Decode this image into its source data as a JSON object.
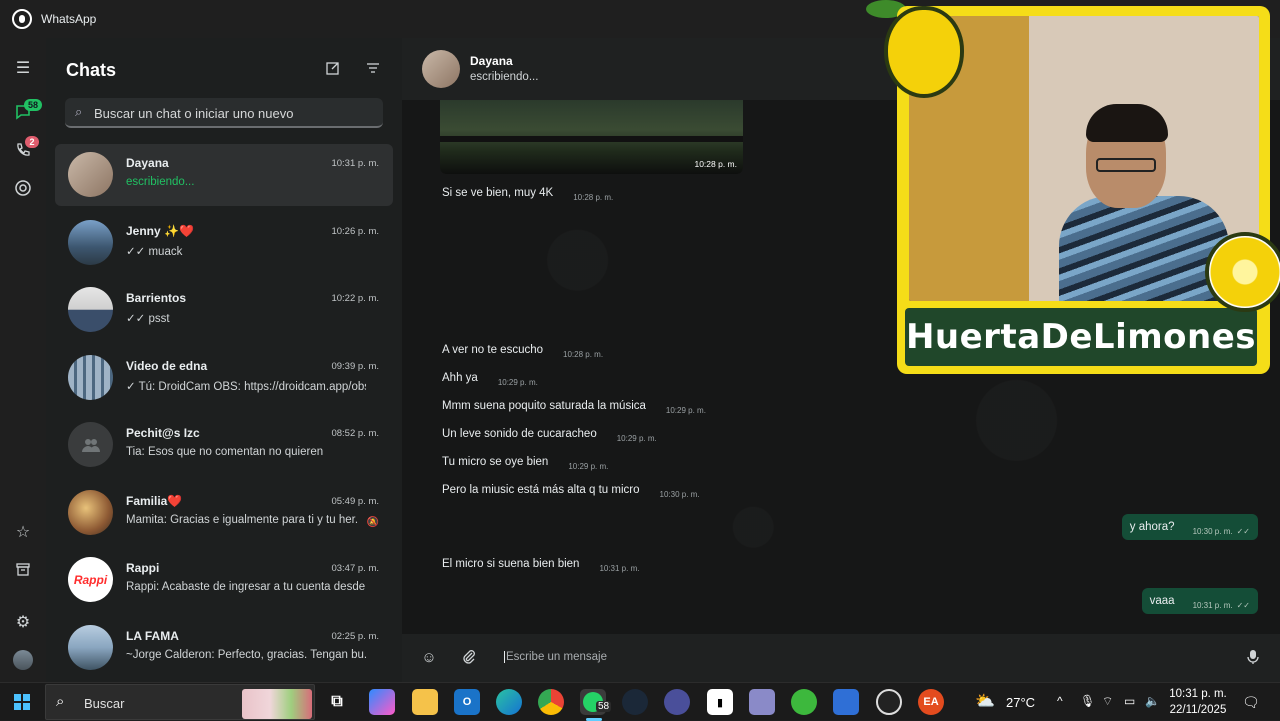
{
  "window": {
    "title": "WhatsApp"
  },
  "rail": {
    "chats_badge": "58",
    "calls_badge": "2"
  },
  "chats": {
    "header": "Chats",
    "search_placeholder": "Buscar un chat o iniciar uno nuevo",
    "items": [
      {
        "name": "Dayana",
        "time": "10:31 p. m.",
        "preview": "escribiendo...",
        "typing": true
      },
      {
        "name": "Jenny ✨❤️",
        "time": "10:26 p. m.",
        "preview": "✓✓ muack"
      },
      {
        "name": "Barrientos",
        "time": "10:22 p. m.",
        "preview": "✓✓ psst"
      },
      {
        "name": "Video de edna",
        "time": "09:39 p. m.",
        "preview": "✓ Tú: DroidCam OBS: https://droidcam.app/obs"
      },
      {
        "name": "Pechit@s Izc",
        "time": "08:52 p. m.",
        "preview": "Tia: Esos que no comentan no quieren"
      },
      {
        "name": "Familia❤️",
        "time": "05:49 p. m.",
        "preview": "Mamita: Gracias e igualmente para ti y tu her..."
      },
      {
        "name": "Rappi",
        "time": "03:47 p. m.",
        "preview": "Rappi: Acabaste de ingresar a tu cuenta desde..."
      },
      {
        "name": "LA FAMA",
        "time": "02:25 p. m.",
        "preview": "~Jorge Calderon: Perfecto, gracias.  Tengan bu..."
      }
    ]
  },
  "conversation": {
    "name": "Dayana",
    "status": "escribiendo...",
    "image_time": "10:28 p. m.",
    "messages": [
      {
        "text": "Si se ve bien, muy 4K",
        "time": "10:28 p. m.",
        "dir": "in"
      },
      {
        "text": "A ver no te escucho",
        "time": "10:28 p. m.",
        "dir": "in"
      },
      {
        "text": "Ahh ya",
        "time": "10:29 p. m.",
        "dir": "in"
      },
      {
        "text": "Mmm suena poquito saturada la música",
        "time": "10:29 p. m.",
        "dir": "in"
      },
      {
        "text": "Un leve sonido de cucaracheo",
        "time": "10:29 p. m.",
        "dir": "in"
      },
      {
        "text": "Tu micro se oye bien",
        "time": "10:29 p. m.",
        "dir": "in"
      },
      {
        "text": "Pero la miusic está más alta q tu micro",
        "time": "10:30 p. m.",
        "dir": "in"
      },
      {
        "text": "y ahora?",
        "time": "10:30 p. m.",
        "dir": "out"
      },
      {
        "text": "El micro si suena bien bien",
        "time": "10:31 p. m.",
        "dir": "in"
      },
      {
        "text": "vaaa",
        "time": "10:31 p. m.",
        "dir": "out"
      }
    ],
    "composer_placeholder": "Escribe un mensaje"
  },
  "overlay": {
    "brand": "HuertaDeLimones"
  },
  "taskbar": {
    "search_placeholder": "Buscar",
    "whatsapp_badge": "58",
    "temperature": "27°C",
    "time": "10:31 p. m.",
    "date": "22/11/2025"
  },
  "colors": {
    "accent_green": "#21c063",
    "outgoing_bubble": "#144d37",
    "badge_red": "#e05d6e",
    "brand_yellow": "#f5dd18",
    "brand_green": "#20472a"
  }
}
